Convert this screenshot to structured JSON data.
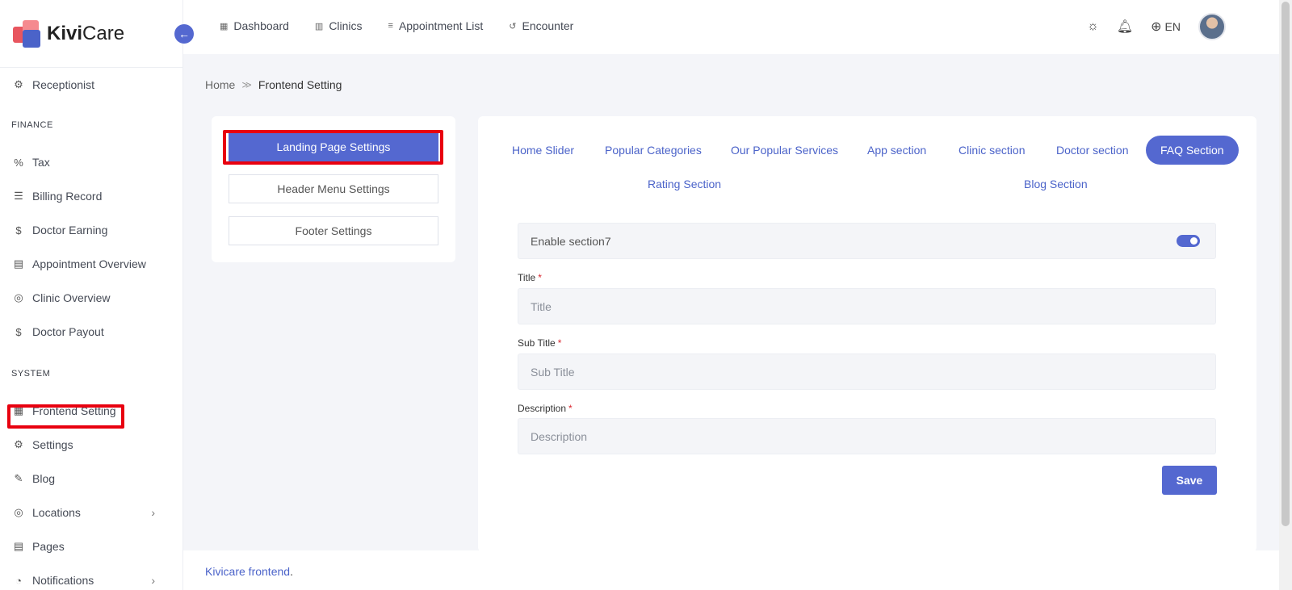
{
  "app": {
    "logo_bold": "Kivi",
    "logo_rest": "Care"
  },
  "sidebar": {
    "items_top": [
      {
        "label": "Receptionist",
        "icon": "receptionist-icon"
      }
    ],
    "finance_title": "FINANCE",
    "finance_items": [
      {
        "label": "Tax",
        "icon": "percent-icon"
      },
      {
        "label": "Billing Record",
        "icon": "billing-icon"
      },
      {
        "label": "Doctor Earning",
        "icon": "dollar-icon"
      },
      {
        "label": "Appointment Overview",
        "icon": "document-icon"
      },
      {
        "label": "Clinic Overview",
        "icon": "location-pin-icon"
      },
      {
        "label": "Doctor Payout",
        "icon": "dollar-icon"
      }
    ],
    "system_title": "SYSTEM",
    "system_items": [
      {
        "label": "Frontend Setting",
        "icon": "layout-icon"
      },
      {
        "label": "Settings",
        "icon": "gear-icon"
      },
      {
        "label": "Blog",
        "icon": "pencil-icon"
      },
      {
        "label": "Locations",
        "icon": "location-pin-icon"
      },
      {
        "label": "Pages",
        "icon": "pages-icon"
      },
      {
        "label": "Notifications",
        "icon": "bell-icon"
      }
    ]
  },
  "topnav": {
    "items": [
      {
        "label": "Dashboard",
        "icon": "grid-icon"
      },
      {
        "label": "Clinics",
        "icon": "building-icon"
      },
      {
        "label": "Appointment List",
        "icon": "sliders-icon"
      },
      {
        "label": "Encounter",
        "icon": "history-icon"
      }
    ],
    "lang": "EN"
  },
  "breadcrumb": {
    "home": "Home",
    "current": "Frontend Setting"
  },
  "settings_menu": {
    "landing": "Landing Page Settings",
    "header": "Header Menu Settings",
    "footer": "Footer Settings"
  },
  "tabs": {
    "home_slider": "Home Slider",
    "popular_categories": "Popular Categories",
    "popular_services": "Our Popular Services",
    "app_section": "App section",
    "clinic_section": "Clinic section",
    "doctor_section": "Doctor section",
    "faq_section": "FAQ Section",
    "rating_section": "Rating Section",
    "blog_section": "Blog Section"
  },
  "form": {
    "enable_label": "Enable section7",
    "enabled": true,
    "title_label": "Title",
    "title_placeholder": "Title",
    "subtitle_label": "Sub Title",
    "subtitle_placeholder": "Sub Title",
    "description_label": "Description",
    "description_placeholder": "Description",
    "required_mark": "*",
    "save": "Save"
  },
  "footer": {
    "link": "Kivicare frontend",
    "suffix": "."
  },
  "colors": {
    "accent": "#5468d0",
    "highlight": "#e8000f"
  }
}
